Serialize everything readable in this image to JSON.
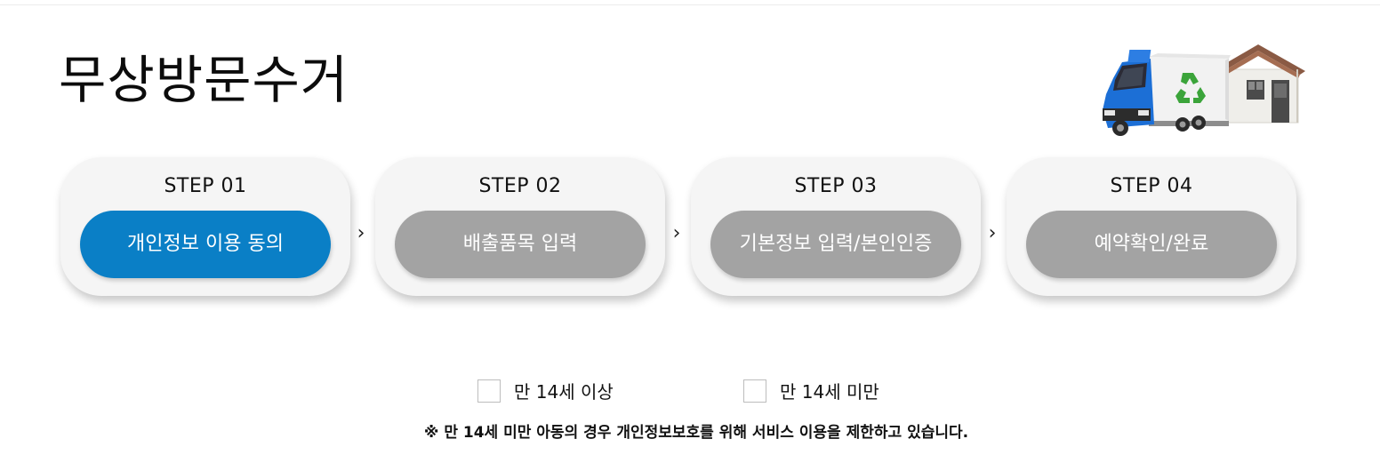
{
  "page": {
    "title": "무상방문수거"
  },
  "steps": [
    {
      "label": "STEP 01",
      "action": "개인정보 이용 동의",
      "active": true
    },
    {
      "label": "STEP 02",
      "action": "배출품목 입력",
      "active": false
    },
    {
      "label": "STEP 03",
      "action": "기본정보 입력/본인인증",
      "active": false
    },
    {
      "label": "STEP 04",
      "action": "예약확인/완료",
      "active": false
    }
  ],
  "step_separator_icon": "chevron-right-icon",
  "age_options": [
    {
      "label": "만 14세 이상",
      "checked": false
    },
    {
      "label": "만 14세 미만",
      "checked": false
    }
  ],
  "notice": "※ 만 14세 미만 아동의 경우 개인정보보호를 위해 서비스 이용을 제한하고 있습니다.",
  "colors": {
    "active_step": "#0a7fc6",
    "inactive_step": "#a3a3a3",
    "card_background": "#f5f5f5"
  },
  "illustration": {
    "icons": [
      "truck-icon",
      "recycle-icon",
      "house-icon"
    ]
  }
}
